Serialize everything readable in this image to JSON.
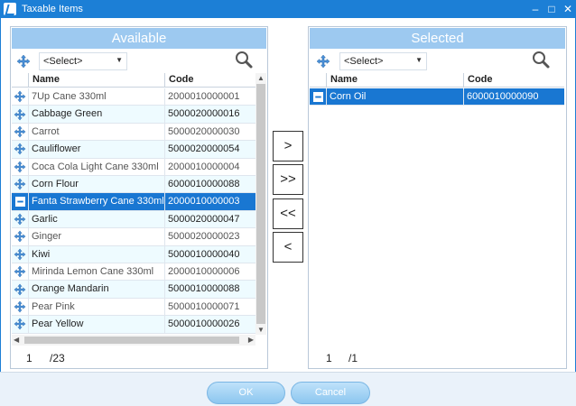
{
  "window": {
    "title": "Taxable Items",
    "controls": [
      "–",
      "□",
      "✕"
    ]
  },
  "available": {
    "header": "Available",
    "select_value": "<Select>",
    "columns": [
      "Name",
      "Code"
    ],
    "rows": [
      {
        "name": "7Up Cane 330ml",
        "code": "2000010000001"
      },
      {
        "name": "Cabbage Green",
        "code": "5000020000016"
      },
      {
        "name": "Carrot",
        "code": "5000020000030"
      },
      {
        "name": "Cauliflower",
        "code": "5000020000054"
      },
      {
        "name": "Coca Cola Light Cane 330ml",
        "code": "2000010000004"
      },
      {
        "name": "Corn Flour",
        "code": "6000010000088"
      },
      {
        "name": "Fanta Strawberry Cane 330ml",
        "code": "2000010000003"
      },
      {
        "name": "Garlic",
        "code": "5000020000047"
      },
      {
        "name": "Ginger",
        "code": "5000020000023"
      },
      {
        "name": "Kiwi",
        "code": "5000010000040"
      },
      {
        "name": "Mirinda Lemon Cane 330ml",
        "code": "2000010000006"
      },
      {
        "name": "Orange Mandarin",
        "code": "5000010000088"
      },
      {
        "name": "Pear Pink",
        "code": "5000010000071"
      },
      {
        "name": "Pear Yellow",
        "code": "5000010000026"
      }
    ],
    "page": "1",
    "total_pages": "/23"
  },
  "selected": {
    "header": "Selected",
    "select_value": "<Select>",
    "columns": [
      "Name",
      "Code"
    ],
    "rows": [
      {
        "name": "Corn Oil",
        "code": "6000010000090"
      }
    ],
    "page": "1",
    "total_pages": "/1"
  },
  "move_buttons": {
    "add_one": ">",
    "add_all": ">>",
    "remove_all": "<<",
    "remove_one": "<"
  },
  "buttons": {
    "ok": "OK",
    "cancel": "Cancel"
  },
  "colors": {
    "title_bar": "#1c7fd6",
    "panel_header": "#9dc9f0",
    "selection": "#1977d2",
    "alt_row": "#eefbff"
  }
}
